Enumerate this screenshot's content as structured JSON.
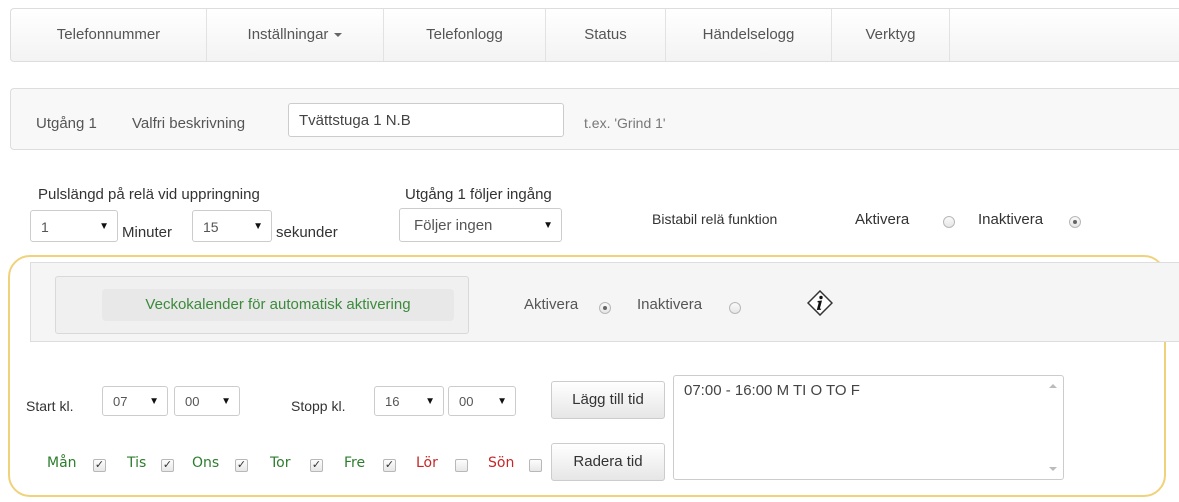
{
  "nav": {
    "items": [
      "Telefonnummer",
      "Inställningar",
      "Telefonlogg",
      "Status",
      "Händelselogg",
      "Verktyg"
    ]
  },
  "output": {
    "label": "Utgång 1",
    "description_label": "Valfri beskrivning",
    "description_value": "Tvättstuga 1 N.B",
    "hint": "t.ex. 'Grind 1'"
  },
  "pulse": {
    "label": "Pulslängd på relä vid uppringning",
    "minutes_value": "1",
    "minutes_label": "Minuter",
    "seconds_value": "15",
    "seconds_label": "sekunder"
  },
  "follows": {
    "label": "Utgång 1 följer ingång",
    "value": "Följer ingen"
  },
  "bistable": {
    "label": "Bistabil relä funktion",
    "activate_label": "Aktivera",
    "deactivate_label": "Inaktivera",
    "selected": "Inaktivera"
  },
  "weekly": {
    "button_label": "Veckokalender för automatisk aktivering",
    "activate_label": "Aktivera",
    "deactivate_label": "Inaktivera",
    "selected": "Aktivera"
  },
  "schedule": {
    "start_label": "Start kl.",
    "start_hour": "07",
    "start_minute": "00",
    "stop_label": "Stopp kl.",
    "stop_hour": "16",
    "stop_minute": "00",
    "add_button": "Lägg till tid",
    "remove_button": "Radera tid",
    "entries_text": "07:00 - 16:00 M TI O TO F",
    "days": [
      {
        "label": "Mån",
        "checked": true,
        "color": "#2e7d2e"
      },
      {
        "label": "Tis",
        "checked": true,
        "color": "#2e7d2e"
      },
      {
        "label": "Ons",
        "checked": true,
        "color": "#2e7d2e"
      },
      {
        "label": "Tor",
        "checked": true,
        "color": "#2e7d2e"
      },
      {
        "label": "Fre",
        "checked": true,
        "color": "#2e7d2e"
      },
      {
        "label": "Lör",
        "checked": false,
        "color": "#c62828"
      },
      {
        "label": "Sön",
        "checked": false,
        "color": "#c62828"
      }
    ]
  },
  "colors": {
    "accent_green": "#3c8a3c",
    "highlight_border": "#f0d27a"
  }
}
